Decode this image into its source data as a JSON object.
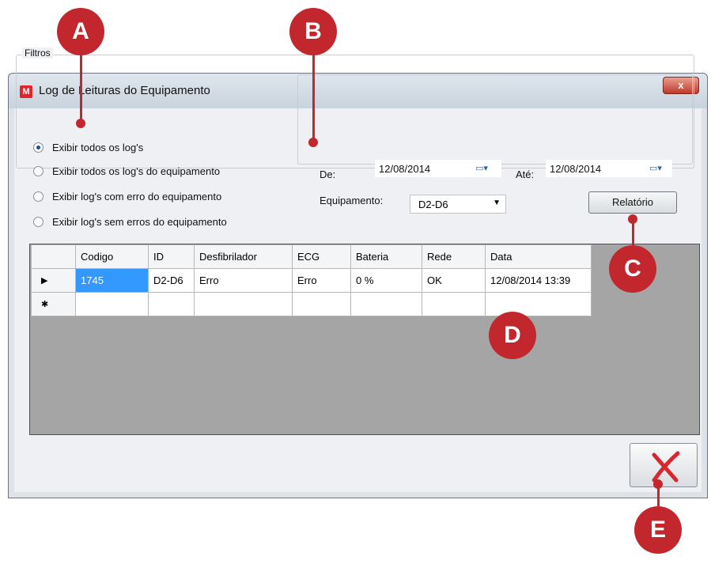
{
  "window": {
    "title": "Log de Leituras do Equipamento",
    "app_icon_letter": "M",
    "close_glyph": "x"
  },
  "filters": {
    "group_label": "Filtros",
    "options": [
      {
        "label": "Exibir todos os log's",
        "selected": true
      },
      {
        "label": "Exibir todos os log's do equipamento",
        "selected": false
      },
      {
        "label": "Exibir log's com erro do equipamento",
        "selected": false
      },
      {
        "label": "Exibir log's sem erros do equipamento",
        "selected": false
      }
    ]
  },
  "range": {
    "from_label": "De:",
    "from_value": "12/08/2014",
    "to_label": "Até:",
    "to_value": "12/08/2014",
    "equipment_label": "Equipamento:",
    "equipment_value": "D2-D6",
    "report_button": "Relatório"
  },
  "grid": {
    "columns": [
      "Codigo",
      "ID",
      "Desfibrilador",
      "ECG",
      "Bateria",
      "Rede",
      "Data"
    ],
    "rows": [
      {
        "marker": "▶",
        "cells": [
          "1745",
          "D2-D6",
          "Erro",
          "Erro",
          "0 %",
          "OK",
          "12/08/2014 13:39"
        ]
      },
      {
        "marker": "✱",
        "cells": [
          "",
          "",
          "",
          "",
          "",
          "",
          ""
        ]
      }
    ]
  },
  "callouts": [
    "A",
    "B",
    "C",
    "D",
    "E"
  ],
  "colors": {
    "callout": "#c1272d",
    "selection": "#3399ff",
    "cancel_icon": "#d7262d"
  }
}
